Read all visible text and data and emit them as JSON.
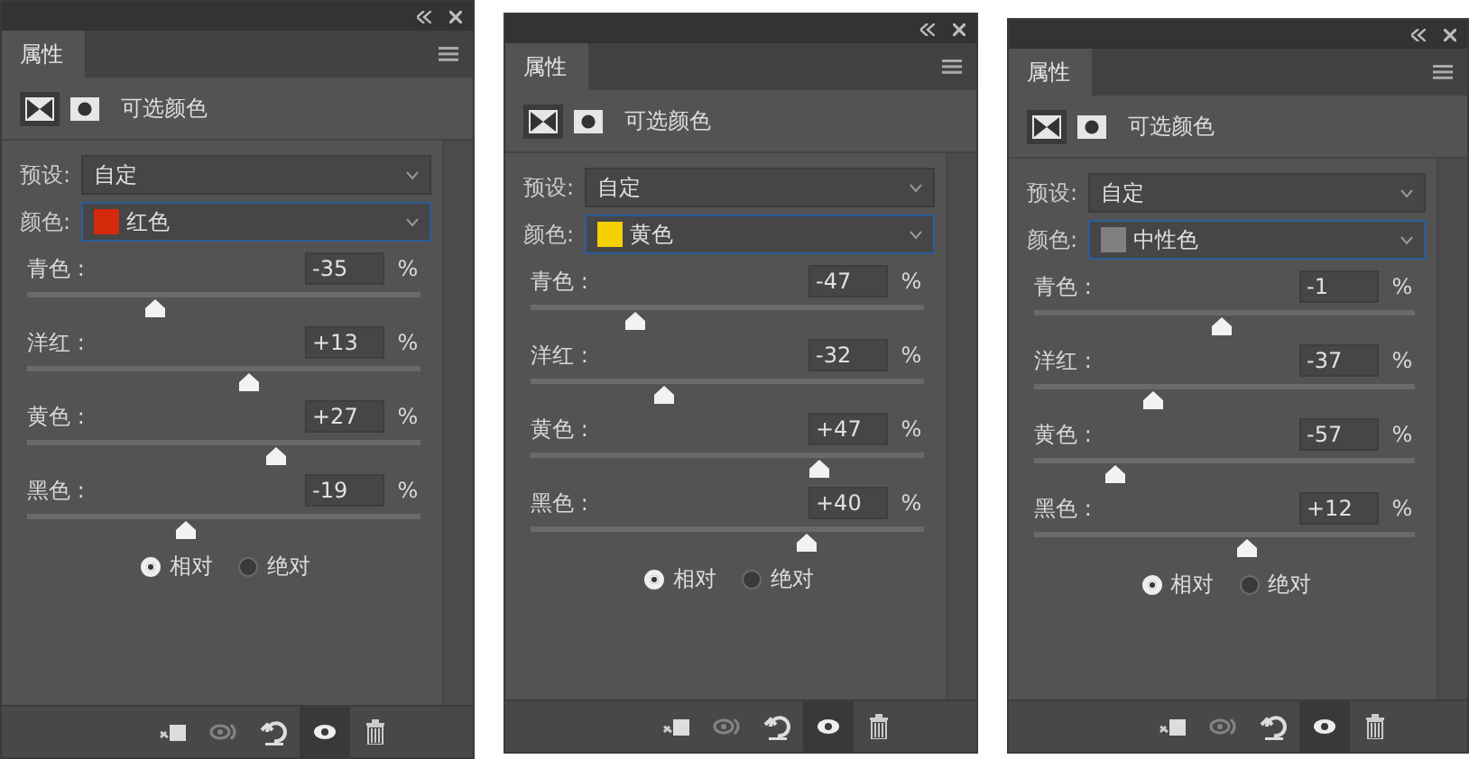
{
  "panels": [
    {
      "tab": {
        "label": "属性",
        "selected": true
      },
      "title": "可选颜色",
      "preset": {
        "label": "预设:",
        "value": "自定"
      },
      "colors": {
        "label": "颜色:",
        "value": "红色",
        "color": "#d42a0c"
      },
      "sliders": [
        {
          "label": "青色 :",
          "value": "-35",
          "unit": "%",
          "level": 0.325
        },
        {
          "label": "洋红 :",
          "value": "+13",
          "unit": "%",
          "level": 0.565
        },
        {
          "label": "黄色 :",
          "value": "+27",
          "unit": "%",
          "level": 0.635
        },
        {
          "label": "黑色 :",
          "value": "-19",
          "unit": "%",
          "level": 0.405
        }
      ],
      "modes": [
        {
          "label": "相对",
          "selected": true
        },
        {
          "label": "绝对",
          "selected": false
        }
      ],
      "toolbar": [
        {
          "kind": "clip",
          "pressed": false,
          "disabled": false
        },
        {
          "kind": "cycle",
          "pressed": false,
          "disabled": true
        },
        {
          "kind": "reset",
          "pressed": false,
          "disabled": false
        },
        {
          "kind": "eye",
          "pressed": true,
          "disabled": false
        },
        {
          "kind": "trash",
          "pressed": false,
          "disabled": false
        }
      ]
    },
    {
      "tab": {
        "label": "属性",
        "selected": true
      },
      "title": "可选颜色",
      "preset": {
        "label": "预设:",
        "value": "自定"
      },
      "colors": {
        "label": "颜色:",
        "value": "黄色",
        "color": "#f5d000"
      },
      "sliders": [
        {
          "label": "青色 :",
          "value": "-47",
          "unit": "%",
          "level": 0.265
        },
        {
          "label": "洋红 :",
          "value": "-32",
          "unit": "%",
          "level": 0.34
        },
        {
          "label": "黄色 :",
          "value": "+47",
          "unit": "%",
          "level": 0.735
        },
        {
          "label": "黑色 :",
          "value": "+40",
          "unit": "%",
          "level": 0.7
        }
      ],
      "modes": [
        {
          "label": "相对",
          "selected": true
        },
        {
          "label": "绝对",
          "selected": false
        }
      ],
      "toolbar": [
        {
          "kind": "clip",
          "pressed": false,
          "disabled": false
        },
        {
          "kind": "cycle",
          "pressed": false,
          "disabled": true
        },
        {
          "kind": "reset",
          "pressed": false,
          "disabled": false
        },
        {
          "kind": "eye",
          "pressed": true,
          "disabled": false
        },
        {
          "kind": "trash",
          "pressed": false,
          "disabled": false
        }
      ]
    },
    {
      "tab": {
        "label": "属性",
        "selected": true
      },
      "title": "可选颜色",
      "preset": {
        "label": "预设:",
        "value": "自定"
      },
      "colors": {
        "label": "颜色:",
        "value": "中性色",
        "color": "#808080"
      },
      "sliders": [
        {
          "label": "青色 :",
          "value": "-1",
          "unit": "%",
          "level": 0.495
        },
        {
          "label": "洋红 :",
          "value": "-37",
          "unit": "%",
          "level": 0.315
        },
        {
          "label": "黄色 :",
          "value": "-57",
          "unit": "%",
          "level": 0.215
        },
        {
          "label": "黑色 :",
          "value": "+12",
          "unit": "%",
          "level": 0.56
        }
      ],
      "modes": [
        {
          "label": "相对",
          "selected": true
        },
        {
          "label": "绝对",
          "selected": false
        }
      ],
      "toolbar": [
        {
          "kind": "clip",
          "pressed": false,
          "disabled": false
        },
        {
          "kind": "cycle",
          "pressed": false,
          "disabled": true
        },
        {
          "kind": "reset",
          "pressed": false,
          "disabled": false
        },
        {
          "kind": "eye",
          "pressed": true,
          "disabled": false
        },
        {
          "kind": "trash",
          "pressed": false,
          "disabled": false
        }
      ]
    }
  ]
}
